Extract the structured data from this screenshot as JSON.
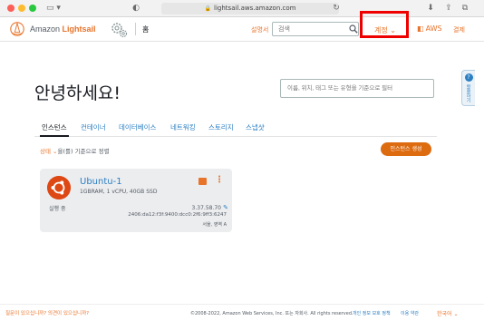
{
  "browser": {
    "url": "lightsail.aws.amazon.com"
  },
  "header": {
    "logo_prefix": "Amazon ",
    "logo_accent": "Lightsail",
    "home_label": "홈",
    "docs_label": "설명서",
    "search_placeholder": "검색",
    "account_label": "계정",
    "aws_label": "AWS",
    "billing_label": "결제"
  },
  "help_tab": {
    "label": "?",
    "text": "활용하기"
  },
  "main": {
    "greeting": "안녕하세요!",
    "filter_placeholder": "이름, 위치, 태그 또는 유형을 기준으로 필터",
    "tabs": [
      {
        "label": "인스턴스",
        "active": true
      },
      {
        "label": "컨테이너",
        "active": false
      },
      {
        "label": "데이터베이스",
        "active": false
      },
      {
        "label": "네트워킹",
        "active": false
      },
      {
        "label": "스토리지",
        "active": false
      },
      {
        "label": "스냅샷",
        "active": false
      }
    ],
    "sort_highlight": "상태",
    "sort_rest": "을(를) 기준으로 정렬",
    "create_button": "인스턴스 생성"
  },
  "instance": {
    "name": "Ubuntu-1",
    "spec": "1GBRAM, 1 vCPU, 40GB SSD",
    "state": "실행 중",
    "ip": "3.37.58.70",
    "ipv6": "2406:da12:f3f:9400:dcc0:2f6:9ff3:6247",
    "region": "서울, 영역 A",
    "os_color": "#dd4814"
  },
  "footer": {
    "feedback": "질문이 있으십니까? 의견이 있으십니까?",
    "copyright": "©2008-2022, Amazon Web Services, Inc. 또는 자회사. All rights reserved.",
    "privacy": "개인 정보 보호 정책",
    "terms": "이용 약관",
    "language": "한국어"
  },
  "colors": {
    "accent": "#e8742b",
    "link": "#2c7fc3",
    "highlight_border": "#ee0000"
  }
}
